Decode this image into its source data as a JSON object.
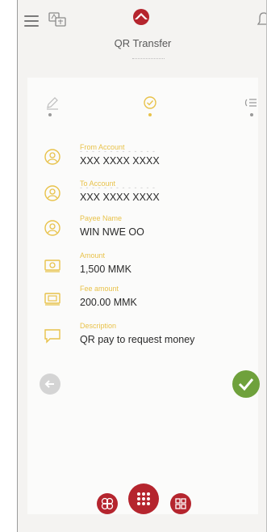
{
  "header": {
    "title": "QR Transfer",
    "icons": [
      "menu-icon",
      "language-icon",
      "logo",
      "notification-bell-icon"
    ]
  },
  "steps": {
    "icons": [
      "edit-pencil-icon",
      "verify-check-icon",
      "receipt-icon"
    ],
    "active_index": 1
  },
  "details": [
    {
      "label": "From Account",
      "masked_top": "- - - - - - - - - - - - -",
      "value": "XXX XXXX XXXX",
      "icon": "user-circle-icon"
    },
    {
      "label": "To Account",
      "masked_top": "- - - - - - - - - - - - -",
      "value": "XXX XXXX XXXX",
      "icon": "user-circle-icon"
    },
    {
      "label": "Payee Name",
      "value": "WIN NWE OO",
      "icon": "user-circle-icon"
    },
    {
      "label": "Amount",
      "value": "1,500 MMK",
      "icon": "money-icon"
    },
    {
      "label": "Fee amount",
      "value": "200.00 MMK",
      "icon": "money-icon"
    },
    {
      "label": "Description",
      "value": "QR pay to request money",
      "icon": "comment-icon"
    }
  ],
  "actions": {
    "back_icon": "arrow-left-icon",
    "confirm_icon": "checkmark-icon"
  },
  "bottom_nav": [
    "qr-scan-icon",
    "apps-grid-icon",
    "qr-code-icon"
  ],
  "colors": {
    "accent": "#e8c24a",
    "brand": "#b5252e",
    "confirm": "#6fa13c"
  }
}
